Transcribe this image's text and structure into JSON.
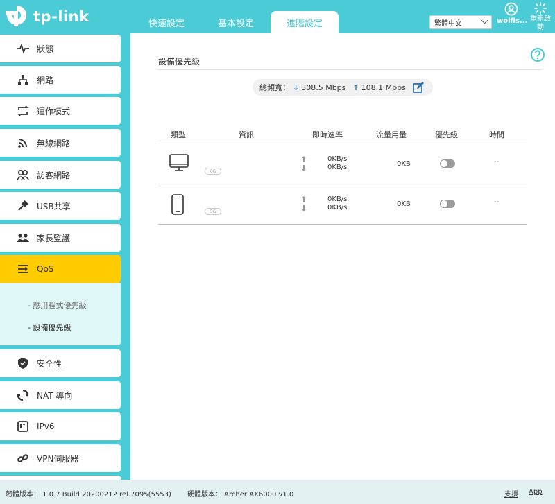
{
  "header": {
    "logo_text": "tp-link",
    "tabs": [
      {
        "label": "快速設定"
      },
      {
        "label": "基本設定"
      },
      {
        "label": "進階設定"
      }
    ],
    "language": "繁體中文",
    "user": "wolfls...",
    "reboot": "重新啟動"
  },
  "sidebar": {
    "items": [
      {
        "label": "狀態",
        "icon": "pulse-icon"
      },
      {
        "label": "網路",
        "icon": "network-icon"
      },
      {
        "label": "運作模式",
        "icon": "mode-icon"
      },
      {
        "label": "無線網路",
        "icon": "wifi-icon"
      },
      {
        "label": "訪客網路",
        "icon": "guest-icon"
      },
      {
        "label": "USB共享",
        "icon": "usb-icon"
      },
      {
        "label": "家長監護",
        "icon": "parental-icon"
      },
      {
        "label": "QoS",
        "icon": "qos-icon"
      },
      {
        "label": "安全性",
        "icon": "shield-icon"
      },
      {
        "label": "NAT 導向",
        "icon": "nat-icon"
      },
      {
        "label": "IPv6",
        "icon": "ipv6-icon"
      },
      {
        "label": "VPN伺服器",
        "icon": "vpn-icon"
      }
    ],
    "qos_sub": [
      {
        "label": "- 應用程式優先級"
      },
      {
        "label": "- 設備優先級"
      }
    ]
  },
  "main": {
    "section_title": "設備優先級",
    "bandwidth": {
      "label": "總頻寬：",
      "down": "308.5 Mbps",
      "up": "108.1 Mbps"
    },
    "table": {
      "headers": [
        "類型",
        "資訊",
        "即時速率",
        "流量用量",
        "優先級",
        "時間"
      ],
      "rows": [
        {
          "device_icon": "desktop-icon",
          "band": "6G",
          "up_rate": "0KB/s",
          "down_rate": "0KB/s",
          "usage": "0KB",
          "priority_on": false,
          "time": "--"
        },
        {
          "device_icon": "phone-icon",
          "band": "5G",
          "up_rate": "0KB/s",
          "down_rate": "0KB/s",
          "usage": "0KB",
          "priority_on": false,
          "time": "--"
        }
      ]
    }
  },
  "footer": {
    "firmware": "韌體版本： 1.0.7 Build 20200212 rel.7095(5553)",
    "hardware": "硬體版本： Archer AX6000 v1.0",
    "support": "支援",
    "app": "App"
  },
  "colors": {
    "brand": "#4acbd6",
    "active_nav": "#ffcc00",
    "sub_bg": "#e0f7f8",
    "arrow": "#2c6fa8"
  }
}
